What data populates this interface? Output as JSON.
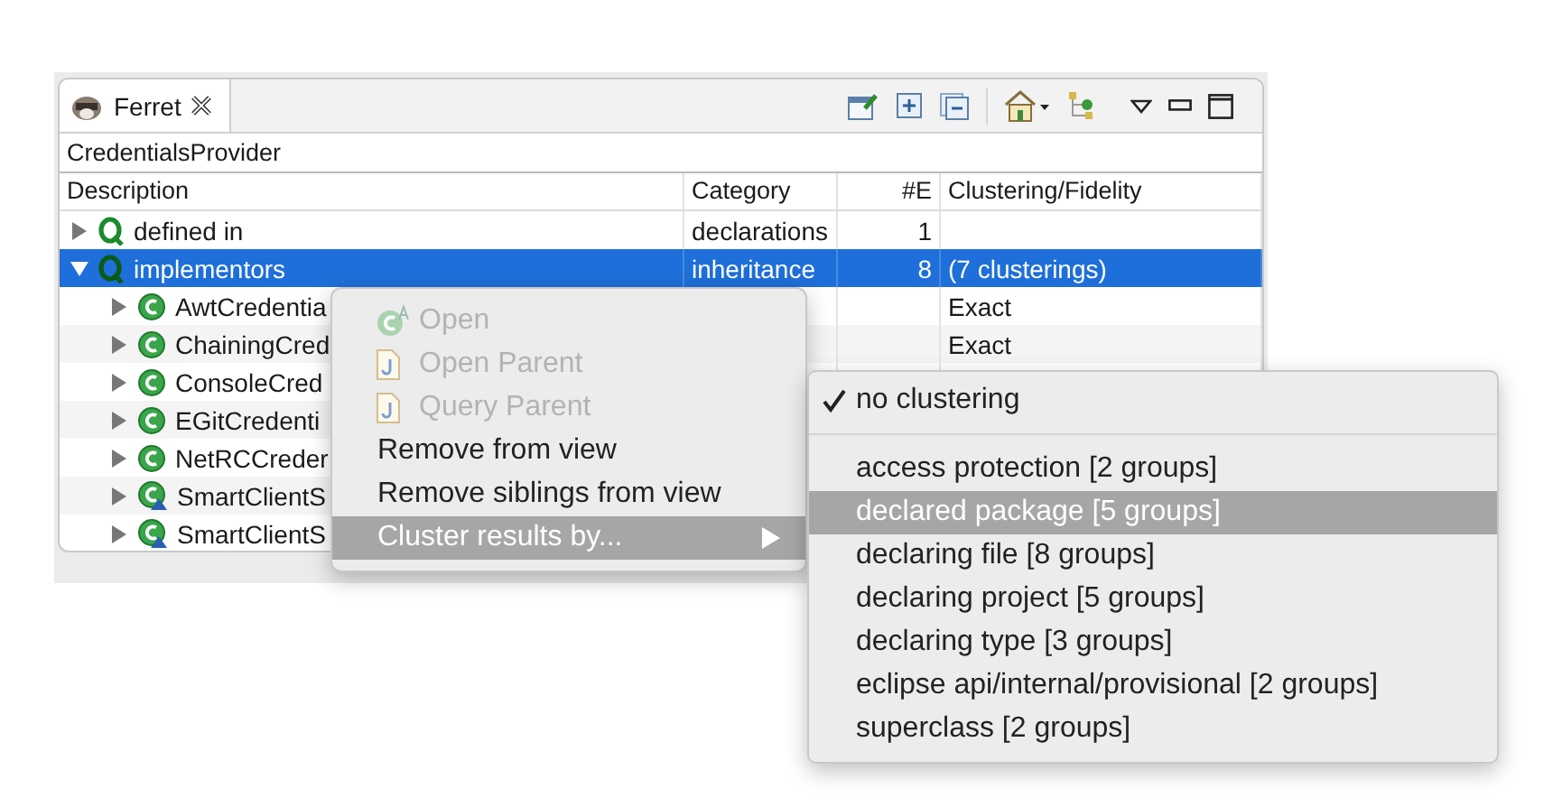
{
  "view": {
    "tab": {
      "title": "Ferret",
      "selected": true
    },
    "breadcrumb": "CredentialsProvider"
  },
  "table": {
    "columns": [
      "Description",
      "Category",
      "#E",
      "Clustering/Fidelity"
    ],
    "rows": [
      {
        "kind": "query",
        "description": "defined in",
        "category": "declarations",
        "count": "1",
        "expanded": false,
        "selected": false
      },
      {
        "kind": "query",
        "description": "implementors",
        "category": "inheritance",
        "count": "8",
        "clustering": "(7 clusterings)",
        "expanded": true,
        "selected": true,
        "children": [
          {
            "kind": "class",
            "description": "AwtCredentia",
            "clustering": "Exact",
            "expanded": false,
            "selected": false
          },
          {
            "kind": "class",
            "description": "ChainingCred",
            "clustering": "Exact",
            "expanded": false,
            "selected": false
          },
          {
            "kind": "class",
            "description": "ConsoleCred",
            "expanded": false,
            "selected": false
          },
          {
            "kind": "class",
            "description": "EGitCredenti",
            "expanded": false,
            "selected": false
          },
          {
            "kind": "class",
            "description": "NetRCCreder",
            "expanded": false,
            "selected": false
          },
          {
            "kind": "subclass",
            "description": "SmartClientS",
            "expanded": false,
            "selected": false
          },
          {
            "kind": "subclass",
            "description": "SmartClientS",
            "expanded": false,
            "selected": false
          }
        ]
      }
    ]
  },
  "context_menu": {
    "items": [
      {
        "label": "Open",
        "kind": "class",
        "disabled": true,
        "selected": false,
        "submenu": false
      },
      {
        "label": "Open Parent",
        "kind": "file",
        "disabled": true,
        "selected": false,
        "submenu": false
      },
      {
        "label": "Query Parent",
        "kind": "file",
        "disabled": true,
        "selected": false,
        "submenu": false
      },
      {
        "label": "Remove from view",
        "kind": "plain",
        "disabled": false,
        "selected": false,
        "submenu": false
      },
      {
        "label": "Remove siblings from view",
        "kind": "plain",
        "disabled": false,
        "selected": false,
        "submenu": false
      },
      {
        "label": "Cluster results by...",
        "kind": "plain",
        "disabled": false,
        "selected": true,
        "submenu": true
      }
    ]
  },
  "submenu": {
    "groups": [
      [
        {
          "label": "no clustering",
          "checked": true,
          "selected": false
        }
      ],
      [
        {
          "label": "access protection [2 groups]",
          "checked": false,
          "selected": false
        },
        {
          "label": "declared package [5 groups]",
          "checked": false,
          "selected": true
        },
        {
          "label": "declaring file [8 groups]",
          "checked": false,
          "selected": false
        },
        {
          "label": "declaring project [5 groups]",
          "checked": false,
          "selected": false
        },
        {
          "label": "declaring type [3 groups]",
          "checked": false,
          "selected": false
        },
        {
          "label": "eclipse api/internal/provisional [2 groups]",
          "checked": false,
          "selected": false
        },
        {
          "label": "superclass [2 groups]",
          "checked": false,
          "selected": false
        }
      ]
    ]
  }
}
